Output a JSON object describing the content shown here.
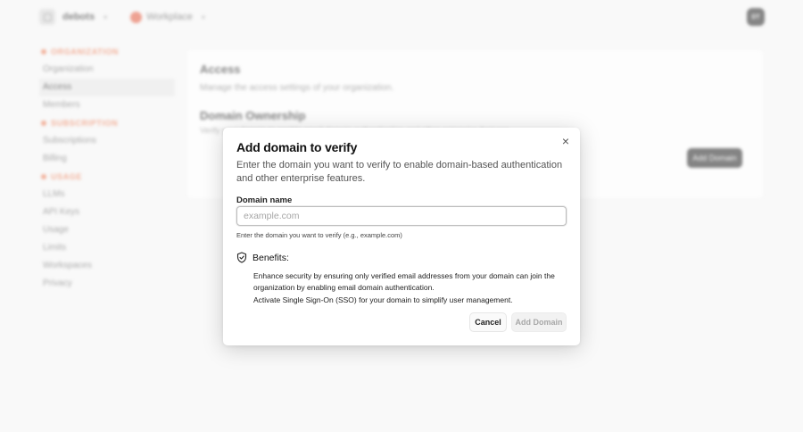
{
  "topbar": {
    "account_name": "debots",
    "project_name": "Workplace",
    "avatar_initials": "DT"
  },
  "sidebar": {
    "sections": [
      {
        "title": "ORGANIZATION",
        "items": [
          "Organization",
          "Access",
          "Members"
        ]
      },
      {
        "title": "SUBSCRIPTION",
        "items": [
          "Subscriptions",
          "Billing"
        ]
      },
      {
        "title": "USAGE",
        "items": [
          "LLMs",
          "API Keys",
          "Usage",
          "Limits",
          "Workspaces",
          "Privacy"
        ]
      }
    ],
    "active_item": "Access"
  },
  "card": {
    "title": "Access",
    "description": "Manage the access settings of your organization.",
    "section_title": "Domain Ownership",
    "section_description": "Verify your domain to enable email domain authentication and other enterprise features.",
    "add_button_label": "Add Domain"
  },
  "modal": {
    "title": "Add domain to verify",
    "description": "Enter the domain you want to verify to enable domain-based authentication and other enterprise features.",
    "field_label": "Domain name",
    "field_value": "",
    "field_placeholder": "example.com",
    "field_hint": "Enter the domain you want to verify (e.g., example.com)",
    "benefits_label": "Benefits:",
    "benefits": [
      "Enhance security by ensuring only verified email addresses from your domain can join the organization by enabling email domain authentication.",
      "Activate Single Sign-On (SSO) for your domain to simplify user management."
    ],
    "cancel_label": "Cancel",
    "submit_label": "Add Domain",
    "close_glyph": "×",
    "icons": {
      "benefits": "shield-check-icon",
      "close": "close-icon"
    }
  }
}
